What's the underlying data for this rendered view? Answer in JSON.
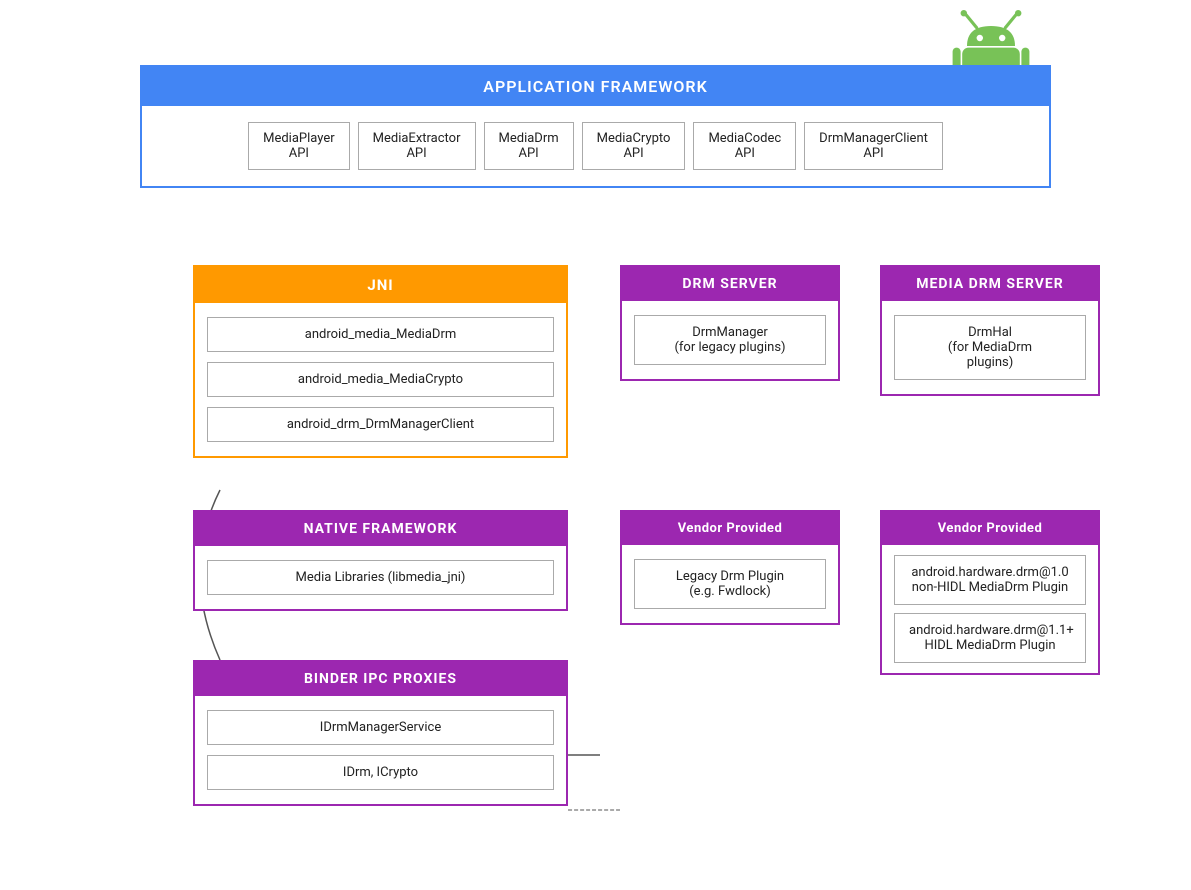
{
  "android_logo": {
    "alt": "Android Logo"
  },
  "app_framework": {
    "header": "APPLICATION FRAMEWORK",
    "apis": [
      "MediaPlayer\nAPI",
      "MediaExtractor\nAPI",
      "MediaDrm\nAPI",
      "MediaCrypto\nAPI",
      "MediaCodec\nAPI",
      "DrmManagerClient\nAPI"
    ]
  },
  "jni": {
    "header": "JNI",
    "items": [
      "android_media_MediaDrm",
      "android_media_MediaCrypto",
      "android_drm_DrmManagerClient"
    ]
  },
  "drm_server": {
    "header": "DRM SERVER",
    "item": "DrmManager\n(for legacy plugins)"
  },
  "media_drm_server": {
    "header": "MEDIA DRM SERVER",
    "item": "DrmHal\n(for MediaDrm\nplugins)"
  },
  "native_framework": {
    "header": "NATIVE FRAMEWORK",
    "item": "Media Libraries (libmedia_jni)"
  },
  "vendor_left": {
    "header": "Vendor Provided",
    "item": "Legacy Drm Plugin\n(e.g. Fwdlock)"
  },
  "vendor_right": {
    "header": "Vendor Provided",
    "items": [
      "android.hardware.drm@1.0\nnon-HIDL MediaDrm Plugin",
      "android.hardware.drm@1.1+\nHIDL MediaDrm Plugin"
    ]
  },
  "binder_ipc": {
    "header": "BINDER IPC PROXIES",
    "items": [
      "IDrmManagerService",
      "IDrm, ICrypto"
    ]
  }
}
